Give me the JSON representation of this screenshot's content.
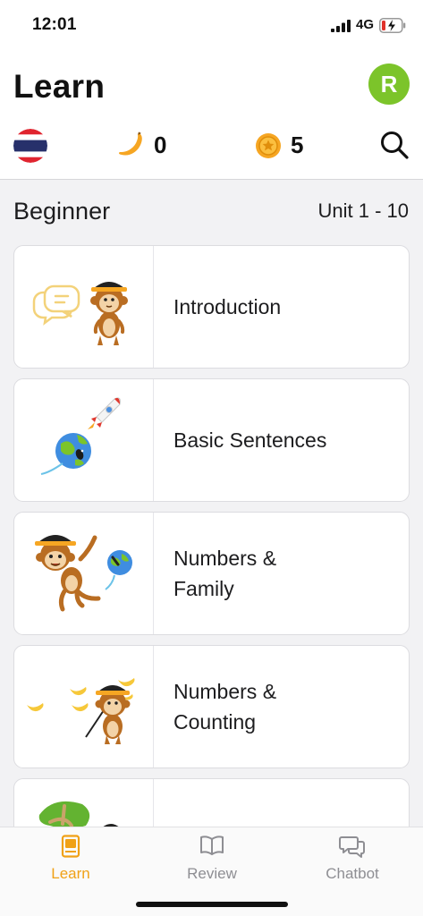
{
  "status_bar": {
    "time": "12:01",
    "network": "4G"
  },
  "header": {
    "title": "Learn",
    "avatar_initial": "R"
  },
  "stats": {
    "bananas": "0",
    "coins": "5"
  },
  "section": {
    "level": "Beginner",
    "units": "Unit 1 - 10"
  },
  "lessons": [
    {
      "title": "Introduction"
    },
    {
      "title": "Basic Sentences"
    },
    {
      "title": "Numbers &\nFamily",
      "line1": "Numbers &",
      "line2": "Family"
    },
    {
      "title": "Numbers &\nCounting",
      "line1": "Numbers &",
      "line2": "Counting"
    },
    {
      "title": ""
    }
  ],
  "tabs": [
    {
      "label": "Learn",
      "icon": "book-icon",
      "active": true
    },
    {
      "label": "Review",
      "icon": "open-book-icon",
      "active": false
    },
    {
      "label": "Chatbot",
      "icon": "chat-bubbles-icon",
      "active": false
    }
  ],
  "colors": {
    "accent": "#f0a116",
    "avatar": "#7cc42a",
    "background": "#f2f2f4"
  }
}
